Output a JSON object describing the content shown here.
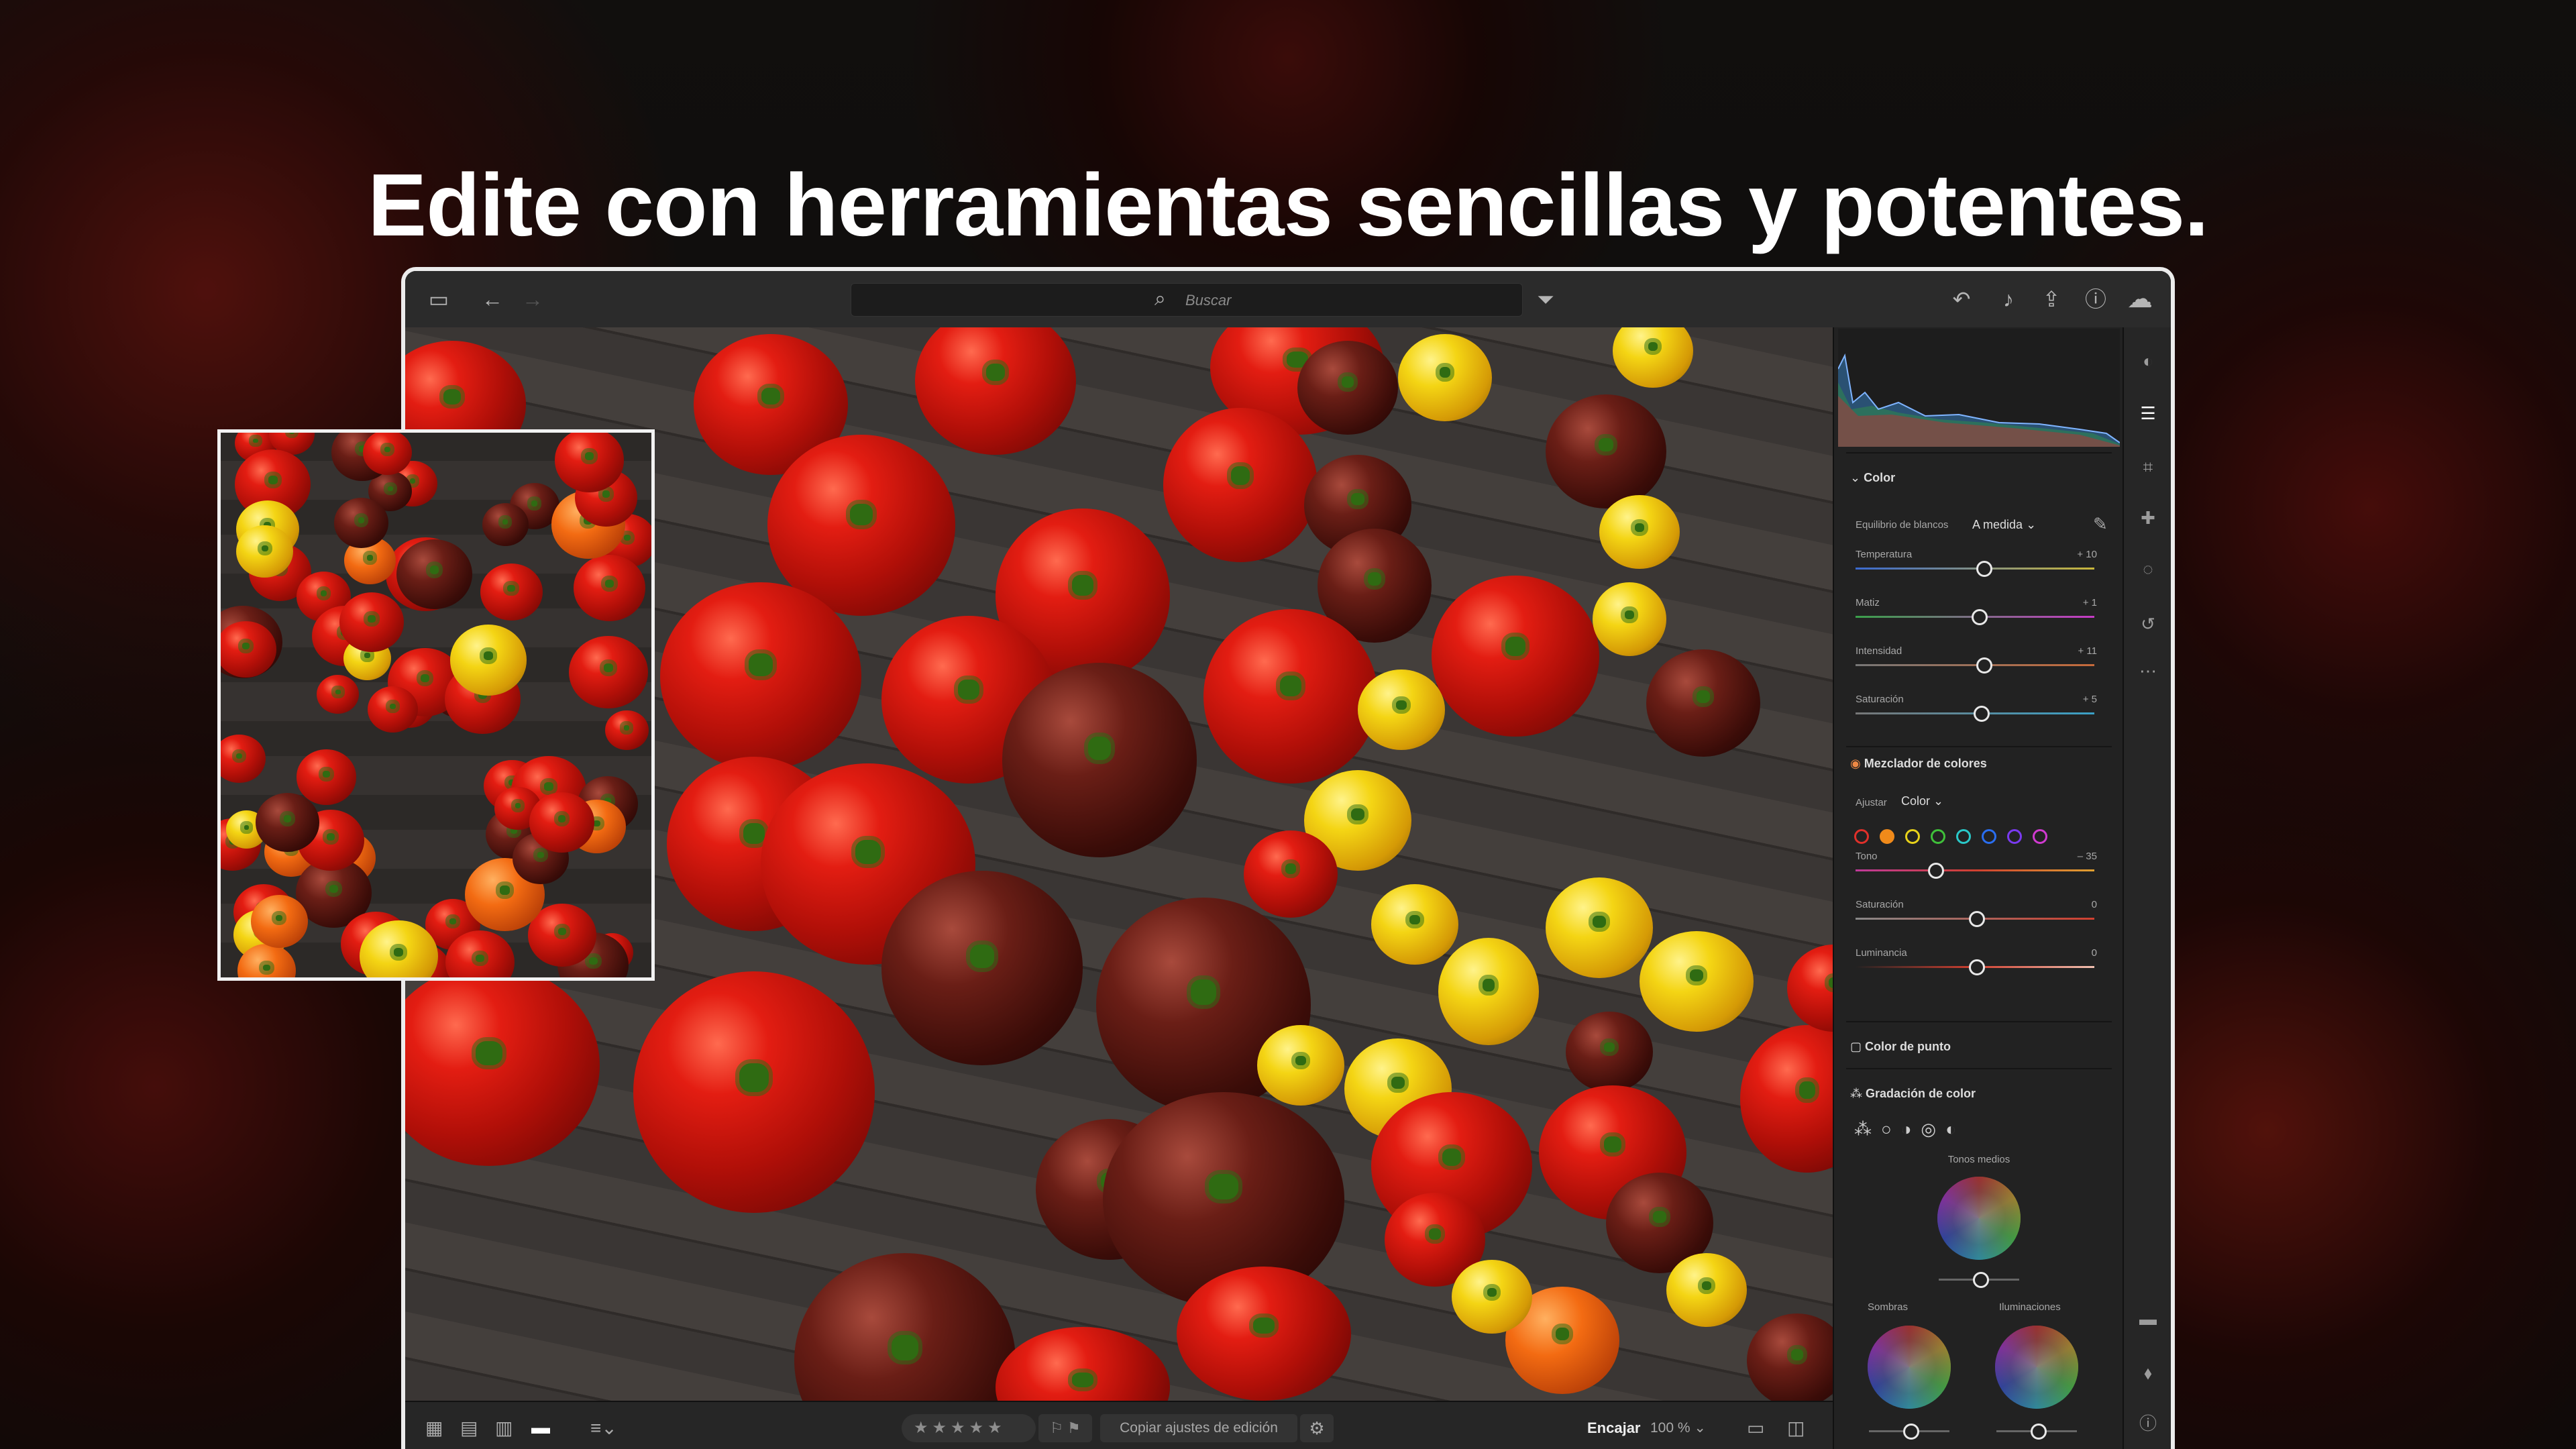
{
  "headline": "Edite con herramientas sencillas y potentes.",
  "topbar": {
    "search_placeholder": "Buscar",
    "icons": [
      "sidebar-icon",
      "back-arrow-icon",
      "forward-arrow-icon",
      "search-icon",
      "filter-icon",
      "undo-icon",
      "bell-icon",
      "share-icon",
      "help-icon",
      "cloud-icon"
    ]
  },
  "panel": {
    "color": {
      "title": "Color",
      "wb_label": "Equilibrio de blancos",
      "wb_value": "A medida",
      "sliders": [
        {
          "label": "Temperatura",
          "value": "+ 10",
          "pos": 0.53
        },
        {
          "label": "Matiz",
          "value": "+ 1",
          "pos": 0.51
        },
        {
          "label": "Intensidad",
          "value": "+ 11",
          "pos": 0.53
        },
        {
          "label": "Saturación",
          "value": "+ 5",
          "pos": 0.52
        }
      ]
    },
    "mixer": {
      "title": "Mezclador de colores",
      "adjust_label": "Ajustar",
      "adjust_value": "Color",
      "swatch_colors": [
        "#e0302a",
        "#f08a1a",
        "#e8d21a",
        "#3fc03a",
        "#2ac8c8",
        "#2a6ef0",
        "#7a3af0",
        "#d03ad0"
      ],
      "sliders": [
        {
          "label": "Tono",
          "value": "– 35",
          "pos": 0.33
        },
        {
          "label": "Saturación",
          "value": "0",
          "pos": 0.5
        },
        {
          "label": "Luminancia",
          "value": "0",
          "pos": 0.5
        }
      ]
    },
    "point_color": {
      "title": "Color de punto"
    },
    "grading": {
      "title": "Gradación de color",
      "midtones_label": "Tonos medios",
      "shadows_label": "Sombras",
      "highlights_label": "Iluminaciones"
    }
  },
  "toolstrip": {
    "icons": [
      "edit-presets-icon",
      "edit-sliders-icon",
      "crop-icon",
      "healing-icon",
      "masking-icon",
      "history-icon",
      "more-icon",
      "comment-icon",
      "tag-icon",
      "info-icon"
    ]
  },
  "bottombar": {
    "stars": "★★★★★",
    "flags": "⚐ ⚑",
    "copy_label": "Copiar ajustes de edición",
    "fit_label": "Encajar",
    "zoom_label": "100 %"
  }
}
